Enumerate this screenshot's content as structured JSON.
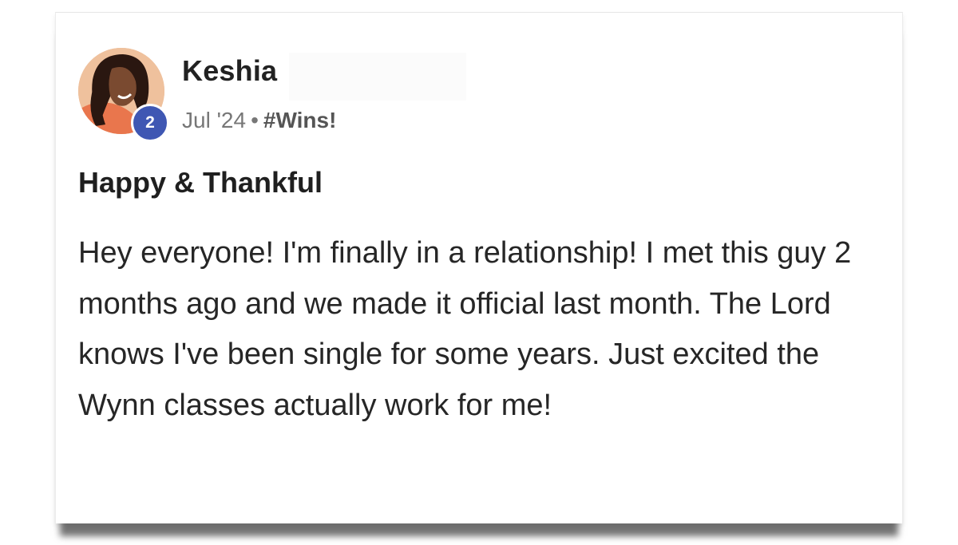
{
  "post": {
    "author": {
      "name": "Keshia",
      "level": "2",
      "avatar_icon": "user-photo-avatar"
    },
    "meta": {
      "date": "Jul '24",
      "separator": "•",
      "category": "#Wins!"
    },
    "title": "Happy & Thankful",
    "body": "Hey everyone! I'm finally in a relationship! I met this guy 2 months ago and we made it official last month. The Lord knows I've been single for some years. Just excited the Wynn classes actually work for me!"
  },
  "colors": {
    "badge": "#3f57b3",
    "text_primary": "#222222",
    "text_meta": "#777777"
  }
}
